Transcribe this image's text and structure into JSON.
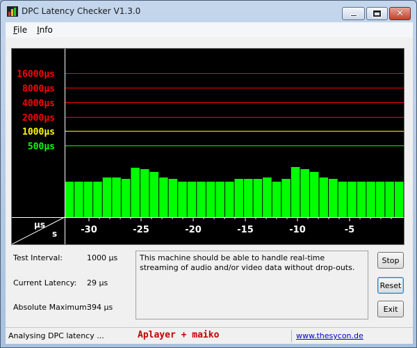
{
  "window": {
    "title": "DPC Latency Checker V1.3.0"
  },
  "menu": [
    {
      "label": "File",
      "key": "F",
      "rest": "ile"
    },
    {
      "label": "Info",
      "key": "I",
      "rest": "nfo"
    }
  ],
  "graph": {
    "levels": [
      {
        "label": "16000µs",
        "value": 16000,
        "color": "#ff0000"
      },
      {
        "label": "8000µs",
        "value": 8000,
        "color": "#ff0000"
      },
      {
        "label": "4000µs",
        "value": 4000,
        "color": "#ff0000"
      },
      {
        "label": "2000µs",
        "value": 2000,
        "color": "#ff0000"
      },
      {
        "label": "1000µs",
        "value": 1000,
        "color": "#ffff00"
      },
      {
        "label": "500µs",
        "value": 500,
        "color": "#00ff00"
      }
    ],
    "corner_top": "µs",
    "corner_bottom": "s",
    "x_ticks": [
      "-30",
      "-25",
      "-20",
      "-15",
      "-10",
      "-5"
    ],
    "bar_color": "#00ff00",
    "latency_us": [
      90,
      90,
      90,
      90,
      110,
      110,
      100,
      170,
      160,
      140,
      110,
      100,
      90,
      90,
      90,
      90,
      90,
      90,
      100,
      100,
      100,
      110,
      90,
      100,
      180,
      160,
      140,
      110,
      100,
      90,
      90,
      90,
      90,
      90,
      90,
      90
    ]
  },
  "info": {
    "test_interval_label": "Test Interval:",
    "test_interval_value": "1000 µs",
    "current_latency_label": "Current Latency:",
    "current_latency_value": "29 µs",
    "absolute_maximum_label": "Absolute Maximum:",
    "absolute_maximum_value": "394 µs"
  },
  "message": "This machine should be able to handle real-time streaming of audio and/or video data without drop-outs.",
  "buttons": {
    "stop": "Stop",
    "reset": "Reset",
    "exit": "Exit"
  },
  "status": {
    "text": "Analysing DPC latency ...",
    "watermark": "Aplayer + maiko",
    "link": "www.thesycon.de"
  },
  "colors": {
    "graph_bg": "#000000",
    "grid": "#ffffff"
  }
}
